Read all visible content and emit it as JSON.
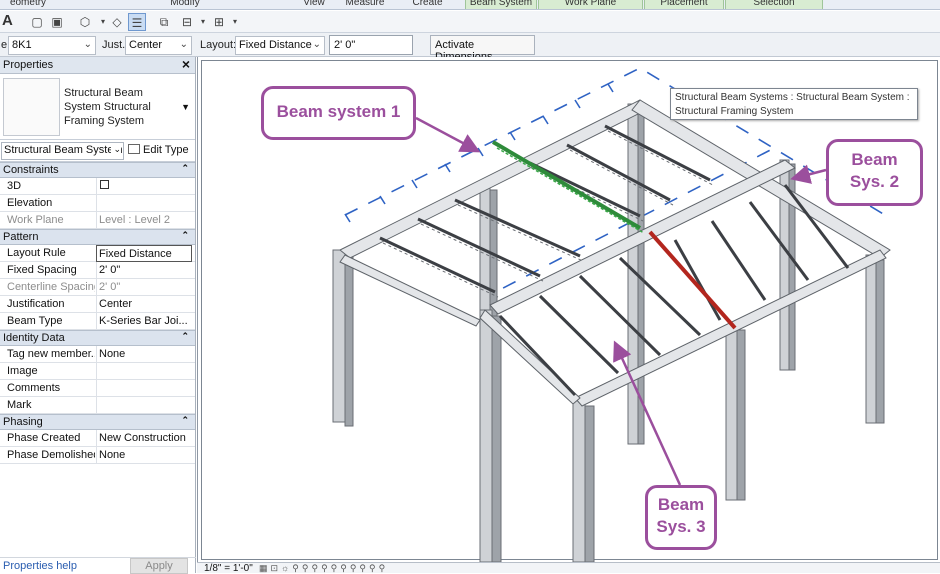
{
  "ribbon": {
    "tabs": [
      {
        "label": "eometry"
      },
      {
        "label": "Modify"
      },
      {
        "label": "View"
      },
      {
        "label": "Measure"
      },
      {
        "label": "Create"
      },
      {
        "label": "Beam System"
      },
      {
        "label": "Work Plane"
      },
      {
        "label": "Placement"
      },
      {
        "label": "Selection"
      }
    ]
  },
  "quick_access": {
    "letter": "A",
    "icons": [
      "wall-icon",
      "sheet-icon",
      "component-icon",
      "erase-icon",
      "properties-icon",
      "copy-icon",
      "windows-icon",
      "split-icon",
      "dropdown-icon"
    ]
  },
  "options_bar": {
    "type_label": "e:",
    "type_value": "8K1",
    "just_label": "Just.:",
    "just_value": "Center",
    "layout_label": "Layout:",
    "layout_value": "Fixed Distance",
    "spacing_value": "2'  0\"",
    "activate_dimensions": "Activate Dimensions"
  },
  "properties": {
    "title": "Properties",
    "type_name": "Structural Beam System Structural Framing System",
    "instance_selector": "Structural Beam System",
    "edit_type": "Edit Type",
    "sections": [
      {
        "name": "Constraints",
        "rows": [
          {
            "name": "3D",
            "value": "",
            "checkbox": true,
            "grayed": false
          },
          {
            "name": "Elevation",
            "value": "",
            "grayed": false
          },
          {
            "name": "Work Plane",
            "value": "Level : Level 2",
            "grayed": true
          }
        ]
      },
      {
        "name": "Pattern",
        "rows": [
          {
            "name": "Layout Rule",
            "value": "Fixed Distance",
            "grayed": false,
            "editing": true
          },
          {
            "name": "Fixed Spacing",
            "value": "2'  0\"",
            "grayed": false
          },
          {
            "name": "Centerline Spacing",
            "value": "2'  0\"",
            "grayed": true
          },
          {
            "name": "Justification",
            "value": "Center",
            "grayed": false
          },
          {
            "name": "Beam Type",
            "value": "K-Series Bar Joi...",
            "grayed": false
          }
        ]
      },
      {
        "name": "Identity Data",
        "rows": [
          {
            "name": "Tag new member...",
            "value": "None",
            "grayed": false
          },
          {
            "name": "Image",
            "value": "",
            "grayed": false
          },
          {
            "name": "Comments",
            "value": "",
            "grayed": false
          },
          {
            "name": "Mark",
            "value": "",
            "grayed": false
          }
        ]
      },
      {
        "name": "Phasing",
        "rows": [
          {
            "name": "Phase Created",
            "value": "New Construction",
            "grayed": false
          },
          {
            "name": "Phase Demolished",
            "value": "None",
            "grayed": false
          }
        ]
      }
    ],
    "help_link": "Properties help",
    "apply": "Apply"
  },
  "canvas": {
    "tooltip": "Structural Beam Systems : Structural Beam System : Structural Framing System",
    "callouts": {
      "b1": [
        "Beam system 1"
      ],
      "b2": [
        "Beam",
        "Sys. 2"
      ],
      "b3": [
        "Beam",
        "Sys. 3"
      ]
    },
    "scale": "1/8\" = 1'-0\"",
    "highlight_colors": {
      "system1": "#2e8b3a",
      "system2": "#b3261e",
      "callout": "#9b4f9d",
      "dashed": "#2f63c4"
    }
  }
}
